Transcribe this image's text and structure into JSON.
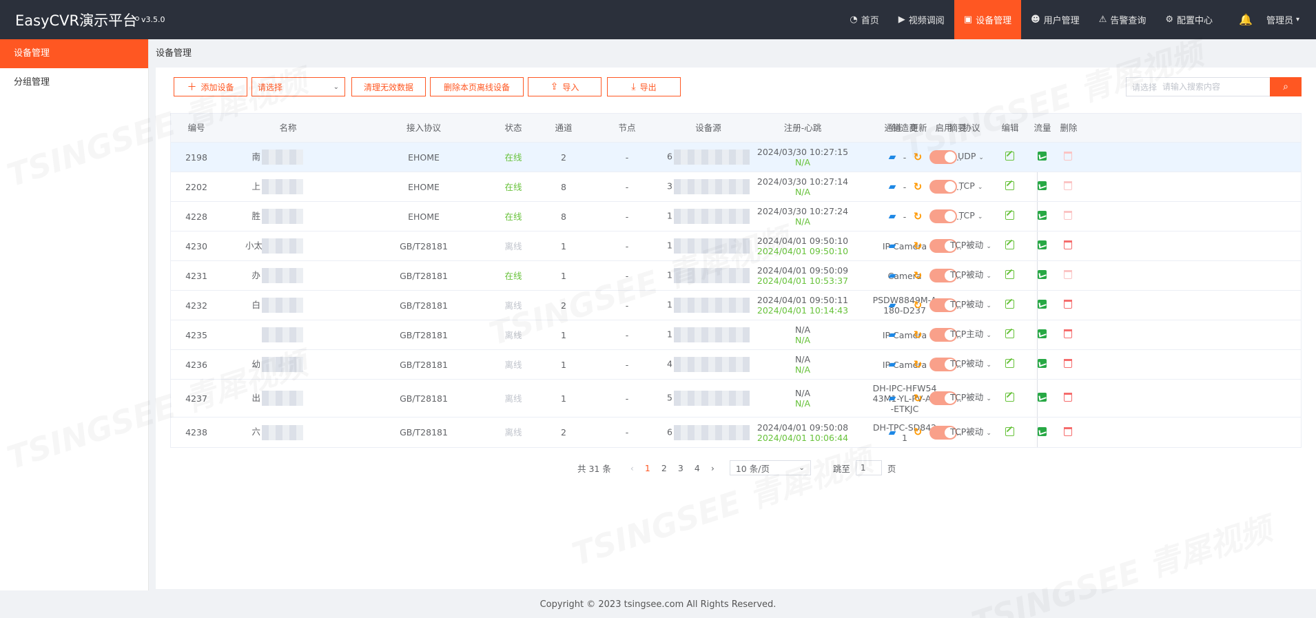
{
  "app": {
    "title": "EasyCVR演示平台",
    "version": "v3.5.0",
    "user": "管理员",
    "accent": "#ff5722"
  },
  "nav": {
    "items": [
      {
        "label": "首页",
        "icon": "dashboard-icon"
      },
      {
        "label": "视频调阅",
        "icon": "play-icon"
      },
      {
        "label": "设备管理",
        "icon": "device-icon",
        "active": true
      },
      {
        "label": "用户管理",
        "icon": "user-icon"
      },
      {
        "label": "告警查询",
        "icon": "alarm-icon"
      },
      {
        "label": "配置中心",
        "icon": "gear-icon"
      }
    ]
  },
  "sidebar": {
    "items": [
      {
        "label": "设备管理",
        "active": true
      },
      {
        "label": "分组管理"
      }
    ]
  },
  "breadcrumb": "设备管理",
  "toolbar": {
    "add_label": "添加设备",
    "select_label": "请选择",
    "clean_label": "清理无效数据",
    "delete_offline_label": "删除本页离线设备",
    "import_label": "导入",
    "export_label": "导出"
  },
  "search": {
    "select_label": "请选择",
    "placeholder": "请输入搜索内容"
  },
  "table": {
    "headers": [
      "编号",
      "名称",
      "接入协议",
      "状态",
      "通道",
      "节点",
      "设备源",
      "注册-心跳",
      "制造商",
      "摘要",
      "通道",
      "更新",
      "启用",
      "协议",
      "编辑",
      "流量",
      "删除"
    ],
    "rows": [
      {
        "id": "2198",
        "name": "南",
        "protocol": "EHOME",
        "status": "在线",
        "online": true,
        "channels": "2",
        "node": "-",
        "source": "6",
        "reg": "2024/03/30 10:27:15",
        "heartbeat": "N/A",
        "maker": "-",
        "summary": "...",
        "proto": "UDP",
        "del_enabled": false,
        "highlight": true
      },
      {
        "id": "2202",
        "name": "上",
        "protocol": "EHOME",
        "status": "在线",
        "online": true,
        "channels": "8",
        "node": "-",
        "source": "3",
        "reg": "2024/03/30 10:27:14",
        "heartbeat": "N/A",
        "maker": "-",
        "summary": "...",
        "proto": "TCP",
        "del_enabled": false
      },
      {
        "id": "4228",
        "name": "胜",
        "protocol": "EHOME",
        "status": "在线",
        "online": true,
        "channels": "8",
        "node": "-",
        "source": "1",
        "reg": "2024/03/30 10:27:24",
        "heartbeat": "N/A",
        "maker": "-",
        "summary": "...",
        "proto": "TCP",
        "del_enabled": false
      },
      {
        "id": "4230",
        "name": "小太",
        "protocol": "GB/T28181",
        "status": "离线",
        "online": false,
        "channels": "1",
        "node": "-",
        "source": "1",
        "reg": "2024/04/01 09:50:10",
        "heartbeat": "2024/04/01 09:50:10",
        "maker": "IP Camera",
        "summary": "...",
        "proto": "TCP被动",
        "del_enabled": true
      },
      {
        "id": "4231",
        "name": "办",
        "protocol": "GB/T28181",
        "status": "在线",
        "online": true,
        "channels": "1",
        "node": "-",
        "source": "1",
        "reg": "2024/04/01 09:50:09",
        "heartbeat": "2024/04/01 10:53:37",
        "maker": "Camera",
        "summary": "...",
        "proto": "TCP被动",
        "del_enabled": false
      },
      {
        "id": "4232",
        "name": "白",
        "protocol": "GB/T28181",
        "status": "离线",
        "online": false,
        "channels": "2",
        "node": "-",
        "source": "1",
        "reg": "2024/04/01 09:50:11",
        "heartbeat": "2024/04/01 10:14:43",
        "maker": "PSDW8849M-A|180-D237",
        "summary": "...",
        "proto": "TCP被动",
        "del_enabled": true
      },
      {
        "id": "4235",
        "name": "",
        "protocol": "GB/T28181",
        "status": "离线",
        "online": false,
        "channels": "1",
        "node": "-",
        "source": "1",
        "reg": "N/A",
        "heartbeat": "N/A",
        "maker": "IP Camera",
        "summary": "...",
        "proto": "TCP主动",
        "del_enabled": true
      },
      {
        "id": "4236",
        "name": "幼",
        "protocol": "GB/T28181",
        "status": "离线",
        "online": false,
        "channels": "1",
        "node": "-",
        "source": "4",
        "reg": "N/A",
        "heartbeat": "N/A",
        "maker": "IP Camera",
        "summary": "...",
        "proto": "TCP被动",
        "del_enabled": true
      },
      {
        "id": "4237",
        "name": "出",
        "protocol": "GB/T28181",
        "status": "离线",
        "online": false,
        "channels": "1",
        "node": "-",
        "source": "5",
        "reg": "N/A",
        "heartbeat": "N/A",
        "maker": "DH-IPC-HFW54|43M1-YL-PV-AS|-ETKJC",
        "summary": "...",
        "proto": "TCP被动",
        "del_enabled": true,
        "tall": true
      },
      {
        "id": "4238",
        "name": "六",
        "protocol": "GB/T28181",
        "status": "离线",
        "online": false,
        "channels": "2",
        "node": "-",
        "source": "6",
        "reg": "2024/04/01 09:50:08",
        "heartbeat": "2024/04/01 10:06:44",
        "maker": "DH-TPC-SD842|1",
        "summary": "...",
        "proto": "TCP被动",
        "del_enabled": true
      }
    ]
  },
  "pagination": {
    "total": "共 31 条",
    "pages": [
      "1",
      "2",
      "3",
      "4"
    ],
    "current": "1",
    "page_size": "10 条/页",
    "jump_label": "跳至",
    "jump_value": "1",
    "page_suffix": "页"
  },
  "footer": "Copyright © 2023 tsingsee.com All Rights Reserved.",
  "watermark": "TSINGSEE 青犀视频"
}
